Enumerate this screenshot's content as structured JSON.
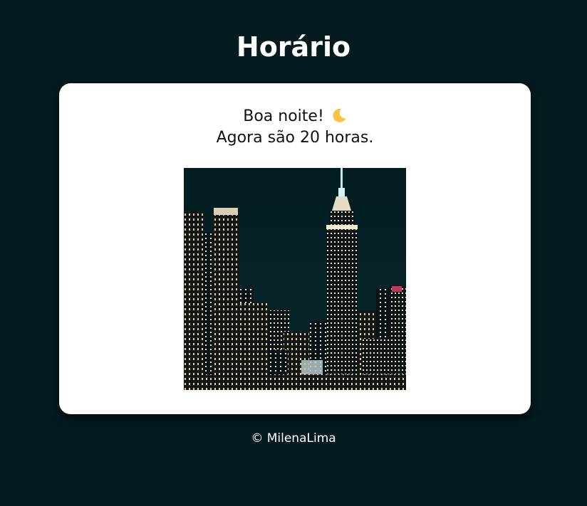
{
  "page": {
    "title": "Horário"
  },
  "card": {
    "greeting_line1": "Boa noite!",
    "greeting_line2": "Agora são 20 horas.",
    "moon_icon": "crescent-moon-icon",
    "image_description_icon": "night-city-skyline-photo"
  },
  "footer": {
    "text": "© MilenaLima"
  },
  "colors": {
    "background": "#051b1e",
    "card": "#ffffff",
    "moon": "#f6c445",
    "sky": "#031c1f"
  }
}
